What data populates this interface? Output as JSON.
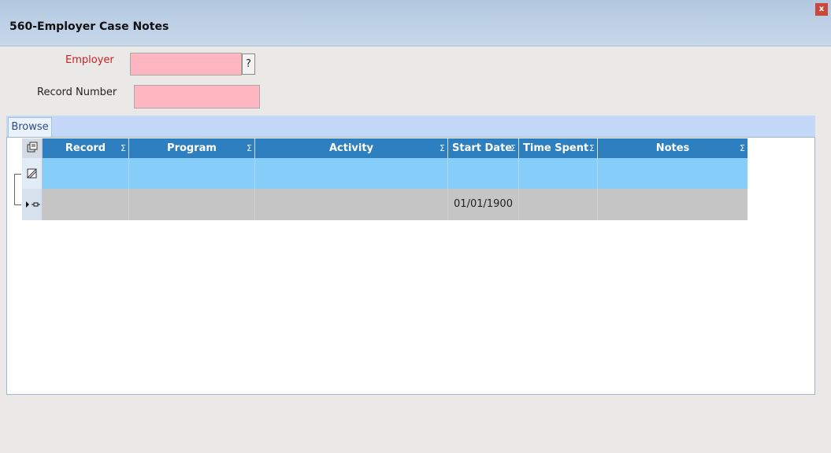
{
  "window": {
    "title": "560-Employer Case Notes",
    "close_glyph": "x"
  },
  "form": {
    "employer_label": "Employer",
    "employer_value": "",
    "employer_help": "?",
    "record_number_label": "Record Number",
    "record_number_value": ""
  },
  "tabs": [
    {
      "label": "Browse"
    }
  ],
  "grid": {
    "columns": [
      {
        "label": "Record",
        "sigma": "Σ"
      },
      {
        "label": "Program",
        "sigma": "Σ"
      },
      {
        "label": "Activity",
        "sigma": "Σ"
      },
      {
        "label": "Start Date",
        "sigma": "Σ"
      },
      {
        "label": "Time Spent",
        "sigma": "Σ"
      },
      {
        "label": "Notes",
        "sigma": "Σ"
      }
    ],
    "rows": [
      {
        "record": "",
        "program": "",
        "activity": "",
        "start_date": "01/01/1900",
        "time_spent": "",
        "notes": ""
      }
    ]
  },
  "colors": {
    "header": "#2e7fc0",
    "filter_row": "#87cdfa",
    "data_row": "#c5c5c5",
    "required_field": "#ffb6c1"
  },
  "icons": {
    "column_chooser": "column-chooser-icon",
    "filter_editor": "filter-editor-icon",
    "current_row": "row-pointer-icon"
  }
}
